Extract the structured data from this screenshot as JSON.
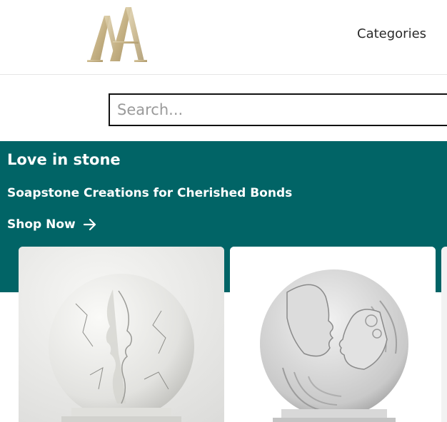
{
  "header": {
    "logo_letters": "AA",
    "nav": {
      "categories_label": "Categories"
    }
  },
  "search": {
    "placeholder": "Search..."
  },
  "hero": {
    "title": "Love in stone",
    "subtitle": "Soapstone Creations for Cherished Bonds",
    "cta_label": "Shop Now",
    "cta_icon": "arrow-right-icon"
  },
  "products": [
    {
      "image": "cracked-stone-faces-kissing-sculpture"
    },
    {
      "image": "carved-couple-faces-circle-sculpture"
    },
    {
      "image": "partial-product-card"
    }
  ],
  "colors": {
    "brand_teal": "#016466",
    "logo_gold": "#c8b68c",
    "text_dark": "#2a2a2a",
    "border": "#111111"
  }
}
